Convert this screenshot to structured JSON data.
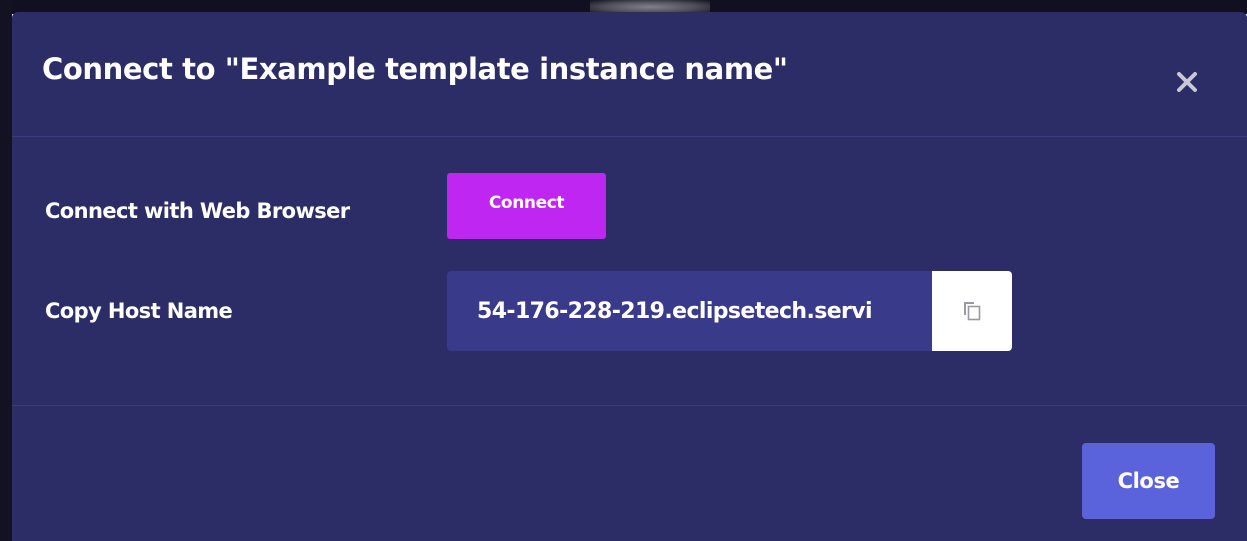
{
  "modal": {
    "title": "Connect to \"Example template instance name\"",
    "close_icon": "close-icon"
  },
  "web_browser": {
    "label": "Connect with Web Browser",
    "button_label": "Connect"
  },
  "host_name": {
    "label": "Copy Host Name",
    "value": "54-176-228-219.eclipsetech.servi",
    "copy_icon": "copy-icon"
  },
  "footer": {
    "close_label": "Close"
  },
  "colors": {
    "modal_background": "#2c2c66",
    "divider": "#3b3b82",
    "connect_button": "#c026f2",
    "host_field": "#3a3a8a",
    "close_button": "#5b63dc"
  }
}
